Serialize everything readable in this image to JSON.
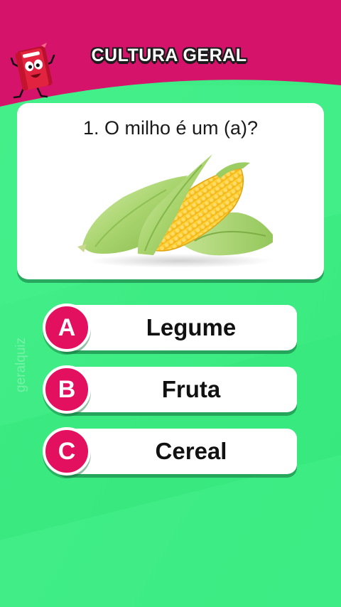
{
  "header": {
    "title": "CULTURA GERAL"
  },
  "question": {
    "text": "1. O milho é um (a)?",
    "image": "corn-cobs"
  },
  "options": [
    {
      "letter": "A",
      "label": "Legume"
    },
    {
      "letter": "B",
      "label": "Fruta"
    },
    {
      "letter": "C",
      "label": "Cereal"
    }
  ],
  "watermark": "geralquiz",
  "colors": {
    "header_magenta": "#d6136a",
    "background_green": "#3ded85",
    "badge_pink": "#e3105f",
    "card_white": "#ffffff"
  }
}
